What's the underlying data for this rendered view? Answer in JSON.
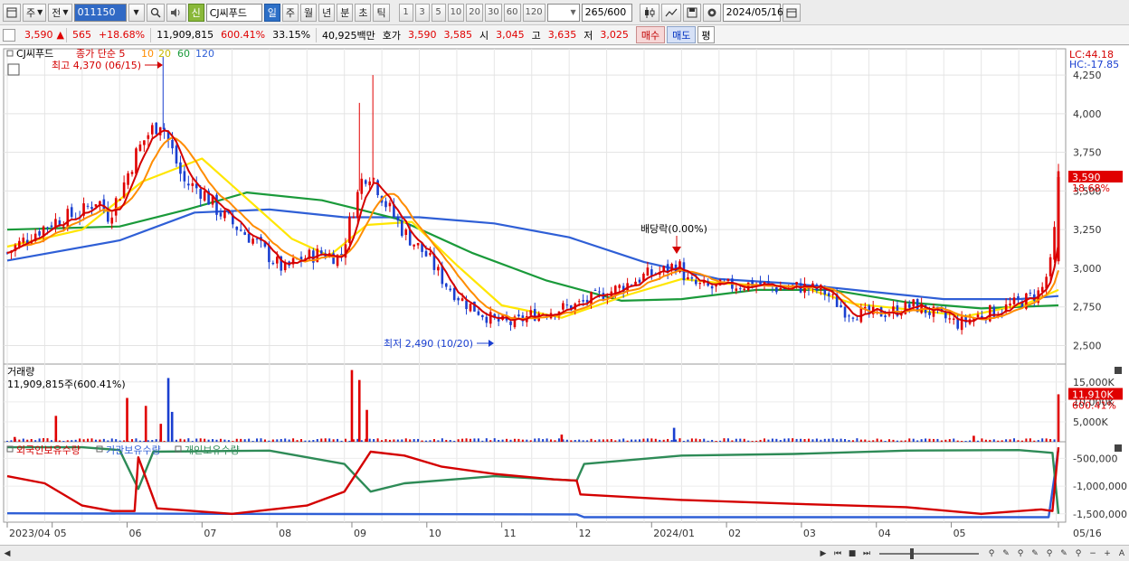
{
  "toolbar": {
    "period_type": "주",
    "compare": "전",
    "code": "011150",
    "badge": "신",
    "stock_name": "CJ씨푸드",
    "period_tabs": [
      "일",
      "주",
      "월",
      "년",
      "분",
      "초",
      "틱"
    ],
    "active_tab": "일",
    "minute_options": [
      "1",
      "3",
      "5",
      "10",
      "20",
      "30",
      "60",
      "120"
    ],
    "view_count": "265",
    "total_count": "/600",
    "date": "2024/05/16"
  },
  "quote": {
    "price": "3,590",
    "change_arrow": "▲",
    "change": "565",
    "change_pct": "+18.68%",
    "volume": "11,909,815",
    "volume_ratio": "600.41%",
    "turnover": "33.15%",
    "amount": "40,925백만",
    "bid_label": "호가",
    "ask": "3,590",
    "bid": "3,585",
    "open_label": "시",
    "open": "3,045",
    "high_label": "고",
    "high": "3,635",
    "low_label": "저",
    "low": "3,025",
    "buy_label": "매수",
    "sell_label": "매도",
    "avg_label": "평"
  },
  "chart_data": {
    "type": "line",
    "price_panel": {
      "stock_label": "CJ씨푸드",
      "legend_prefix": "종가 단순",
      "ma_periods": [
        "5",
        "10",
        "20",
        "60",
        "120"
      ],
      "ma_colors": [
        "#d40000",
        "#ff8c00",
        "#ffe600",
        "#1a9a3a",
        "#2f5fd6"
      ],
      "ylim": [
        2380,
        4420
      ],
      "yticks": [
        "2,500",
        "2,750",
        "3,000",
        "3,250",
        "3,500",
        "3,750",
        "4,000",
        "4,250"
      ],
      "ytick_values": [
        2500,
        2750,
        3000,
        3250,
        3500,
        3750,
        4000,
        4250
      ],
      "corner_top": "LC:44.18",
      "corner_bottom": "HC:-17.85",
      "last_price": "3,590",
      "last_pct": "18.68%",
      "high_annotation": "최고 4,370 (06/15)",
      "low_annotation": "최저 2,490 (10/20)",
      "dividend_annotation": "배당락(0.00%)",
      "close_series": [
        {
          "m": 0.0,
          "v": 3100
        },
        {
          "m": 0.3,
          "v": 3210
        },
        {
          "m": 0.6,
          "v": 3300
        },
        {
          "m": 1.0,
          "v": 3360
        },
        {
          "m": 1.2,
          "v": 3450
        },
        {
          "m": 1.35,
          "v": 3340
        },
        {
          "m": 1.5,
          "v": 3480
        },
        {
          "m": 1.7,
          "v": 3720
        },
        {
          "m": 1.85,
          "v": 3850
        },
        {
          "m": 2.05,
          "v": 3960
        },
        {
          "m": 2.2,
          "v": 3760
        },
        {
          "m": 2.35,
          "v": 3560
        },
        {
          "m": 2.6,
          "v": 3500
        },
        {
          "m": 2.8,
          "v": 3380
        },
        {
          "m": 3.0,
          "v": 3290
        },
        {
          "m": 3.3,
          "v": 3180
        },
        {
          "m": 3.55,
          "v": 3050
        },
        {
          "m": 3.7,
          "v": 2990
        },
        {
          "m": 3.9,
          "v": 3060
        },
        {
          "m": 4.2,
          "v": 3100
        },
        {
          "m": 4.45,
          "v": 3070
        },
        {
          "m": 4.6,
          "v": 3350
        },
        {
          "m": 4.75,
          "v": 3600
        },
        {
          "m": 4.85,
          "v": 3620
        },
        {
          "m": 5.05,
          "v": 3420
        },
        {
          "m": 5.3,
          "v": 3230
        },
        {
          "m": 5.6,
          "v": 3080
        },
        {
          "m": 5.85,
          "v": 2900
        },
        {
          "m": 6.1,
          "v": 2780
        },
        {
          "m": 6.5,
          "v": 2660
        },
        {
          "m": 6.75,
          "v": 2640
        },
        {
          "m": 7.0,
          "v": 2700
        },
        {
          "m": 7.3,
          "v": 2730
        },
        {
          "m": 7.6,
          "v": 2760
        },
        {
          "m": 7.9,
          "v": 2820
        },
        {
          "m": 8.2,
          "v": 2880
        },
        {
          "m": 8.5,
          "v": 2950
        },
        {
          "m": 8.75,
          "v": 2980
        },
        {
          "m": 8.95,
          "v": 3030
        },
        {
          "m": 9.1,
          "v": 2900
        },
        {
          "m": 9.4,
          "v": 2870
        },
        {
          "m": 9.7,
          "v": 2890
        },
        {
          "m": 10.0,
          "v": 2900
        },
        {
          "m": 10.3,
          "v": 2870
        },
        {
          "m": 10.6,
          "v": 2880
        },
        {
          "m": 10.9,
          "v": 2850
        },
        {
          "m": 11.2,
          "v": 2720
        },
        {
          "m": 11.5,
          "v": 2700
        },
        {
          "m": 11.8,
          "v": 2720
        },
        {
          "m": 12.1,
          "v": 2760
        },
        {
          "m": 12.4,
          "v": 2700
        },
        {
          "m": 12.7,
          "v": 2640
        },
        {
          "m": 13.0,
          "v": 2700
        },
        {
          "m": 13.3,
          "v": 2740
        },
        {
          "m": 13.6,
          "v": 2800
        },
        {
          "m": 13.8,
          "v": 2850
        },
        {
          "m": 13.95,
          "v": 3060
        },
        {
          "m": 14.03,
          "v": 3590
        }
      ],
      "ma20_series": [
        {
          "m": 0.0,
          "v": 3140
        },
        {
          "m": 1.0,
          "v": 3250
        },
        {
          "m": 1.8,
          "v": 3560
        },
        {
          "m": 2.6,
          "v": 3710
        },
        {
          "m": 3.2,
          "v": 3450
        },
        {
          "m": 3.8,
          "v": 3190
        },
        {
          "m": 4.3,
          "v": 3080
        },
        {
          "m": 4.8,
          "v": 3280
        },
        {
          "m": 5.4,
          "v": 3300
        },
        {
          "m": 6.0,
          "v": 3020
        },
        {
          "m": 6.6,
          "v": 2760
        },
        {
          "m": 7.4,
          "v": 2680
        },
        {
          "m": 8.3,
          "v": 2830
        },
        {
          "m": 9.0,
          "v": 2930
        },
        {
          "m": 9.6,
          "v": 2900
        },
        {
          "m": 10.6,
          "v": 2880
        },
        {
          "m": 11.3,
          "v": 2770
        },
        {
          "m": 12.1,
          "v": 2730
        },
        {
          "m": 12.8,
          "v": 2690
        },
        {
          "m": 13.6,
          "v": 2770
        },
        {
          "m": 14.03,
          "v": 2860
        }
      ],
      "ma60_series": [
        {
          "m": 0.0,
          "v": 3250
        },
        {
          "m": 1.5,
          "v": 3270
        },
        {
          "m": 2.4,
          "v": 3380
        },
        {
          "m": 3.2,
          "v": 3490
        },
        {
          "m": 4.2,
          "v": 3440
        },
        {
          "m": 5.2,
          "v": 3320
        },
        {
          "m": 6.2,
          "v": 3100
        },
        {
          "m": 7.2,
          "v": 2920
        },
        {
          "m": 8.2,
          "v": 2790
        },
        {
          "m": 9.0,
          "v": 2800
        },
        {
          "m": 10.0,
          "v": 2860
        },
        {
          "m": 11.0,
          "v": 2860
        },
        {
          "m": 12.0,
          "v": 2780
        },
        {
          "m": 13.0,
          "v": 2740
        },
        {
          "m": 14.03,
          "v": 2760
        }
      ],
      "ma120_series": [
        {
          "m": 0.0,
          "v": 3050
        },
        {
          "m": 1.5,
          "v": 3180
        },
        {
          "m": 2.5,
          "v": 3360
        },
        {
          "m": 3.5,
          "v": 3380
        },
        {
          "m": 4.5,
          "v": 3330
        },
        {
          "m": 5.5,
          "v": 3330
        },
        {
          "m": 6.5,
          "v": 3290
        },
        {
          "m": 7.5,
          "v": 3200
        },
        {
          "m": 8.5,
          "v": 3040
        },
        {
          "m": 9.5,
          "v": 2930
        },
        {
          "m": 10.5,
          "v": 2900
        },
        {
          "m": 11.5,
          "v": 2850
        },
        {
          "m": 12.5,
          "v": 2800
        },
        {
          "m": 13.5,
          "v": 2800
        },
        {
          "m": 14.03,
          "v": 2820
        }
      ]
    },
    "volume_panel": {
      "title": "거래량",
      "value_label": "11,909,815주(600.41%)",
      "yticks": [
        "5,000K",
        "10,000K",
        "15,000K"
      ],
      "ytick_values": [
        5000,
        10000,
        15000
      ],
      "ylim": [
        0,
        19500
      ],
      "last_label": "11,910K",
      "last_pct": "600.41%",
      "spikes_k": [
        {
          "m": 0.1,
          "v": 1200,
          "up": true
        },
        {
          "m": 0.65,
          "v": 6500,
          "up": true
        },
        {
          "m": 1.6,
          "v": 11000,
          "up": true
        },
        {
          "m": 1.85,
          "v": 9000,
          "up": true
        },
        {
          "m": 2.05,
          "v": 4500,
          "up": true
        },
        {
          "m": 2.15,
          "v": 16000,
          "up": false
        },
        {
          "m": 2.2,
          "v": 7500,
          "up": false
        },
        {
          "m": 4.6,
          "v": 18000,
          "up": true
        },
        {
          "m": 4.7,
          "v": 15500,
          "up": true
        },
        {
          "m": 4.8,
          "v": 8000,
          "up": true
        },
        {
          "m": 7.4,
          "v": 1800,
          "up": true
        },
        {
          "m": 8.9,
          "v": 3500,
          "up": false
        },
        {
          "m": 12.9,
          "v": 1500,
          "up": true
        },
        {
          "m": 14.03,
          "v": 11910,
          "up": true
        }
      ]
    },
    "holding_panel": {
      "legend": [
        "외국인보유수량",
        "기관보유수량",
        "개인보유수량"
      ],
      "legend_colors": [
        "#d40000",
        "#2f5fd6",
        "#2e8b57"
      ],
      "yticks": [
        "-1,500,000",
        "-1,000,000",
        "-500,000"
      ],
      "ytick_values": [
        -1500000,
        -1000000,
        -500000
      ],
      "ylim": [
        -1650000,
        -200000
      ],
      "foreign_series": [
        {
          "m": 0.0,
          "v": -820000
        },
        {
          "m": 0.5,
          "v": -950000
        },
        {
          "m": 1.0,
          "v": -1350000
        },
        {
          "m": 1.4,
          "v": -1450000
        },
        {
          "m": 1.7,
          "v": -1450000
        },
        {
          "m": 1.75,
          "v": -480000
        },
        {
          "m": 2.0,
          "v": -1400000
        },
        {
          "m": 3.0,
          "v": -1500000
        },
        {
          "m": 4.0,
          "v": -1350000
        },
        {
          "m": 4.5,
          "v": -1100000
        },
        {
          "m": 4.85,
          "v": -380000
        },
        {
          "m": 5.3,
          "v": -450000
        },
        {
          "m": 5.8,
          "v": -650000
        },
        {
          "m": 6.5,
          "v": -780000
        },
        {
          "m": 7.3,
          "v": -880000
        },
        {
          "m": 7.6,
          "v": -900000
        },
        {
          "m": 7.65,
          "v": -1150000
        },
        {
          "m": 9.0,
          "v": -1250000
        },
        {
          "m": 10.5,
          "v": -1320000
        },
        {
          "m": 12.0,
          "v": -1380000
        },
        {
          "m": 13.0,
          "v": -1500000
        },
        {
          "m": 13.8,
          "v": -1420000
        },
        {
          "m": 13.95,
          "v": -1450000
        },
        {
          "m": 14.03,
          "v": -300000
        }
      ],
      "inst_series": [
        {
          "m": 0.0,
          "v": -1490000
        },
        {
          "m": 3.0,
          "v": -1500000
        },
        {
          "m": 7.6,
          "v": -1510000
        },
        {
          "m": 7.7,
          "v": -1560000
        },
        {
          "m": 13.9,
          "v": -1560000
        },
        {
          "m": 14.03,
          "v": -320000
        }
      ],
      "indiv_series": [
        {
          "m": 0.0,
          "v": -300000
        },
        {
          "m": 1.0,
          "v": -300000
        },
        {
          "m": 1.5,
          "v": -350000
        },
        {
          "m": 1.75,
          "v": -1050000
        },
        {
          "m": 1.95,
          "v": -380000
        },
        {
          "m": 3.5,
          "v": -360000
        },
        {
          "m": 4.5,
          "v": -600000
        },
        {
          "m": 4.85,
          "v": -1100000
        },
        {
          "m": 5.3,
          "v": -950000
        },
        {
          "m": 6.5,
          "v": -820000
        },
        {
          "m": 7.6,
          "v": -900000
        },
        {
          "m": 7.7,
          "v": -600000
        },
        {
          "m": 9.0,
          "v": -450000
        },
        {
          "m": 10.5,
          "v": -420000
        },
        {
          "m": 12.0,
          "v": -360000
        },
        {
          "m": 13.5,
          "v": -350000
        },
        {
          "m": 13.95,
          "v": -400000
        },
        {
          "m": 14.03,
          "v": -1500000
        }
      ]
    },
    "x_axis": {
      "labels": [
        "2023/04",
        "05",
        "06",
        "07",
        "08",
        "09",
        "10",
        "11",
        "12",
        "2024/01",
        "02",
        "03",
        "04",
        "05",
        "05/16"
      ],
      "label_months": [
        0.0,
        0.6,
        1.6,
        2.6,
        3.6,
        4.6,
        5.6,
        6.6,
        7.6,
        8.6,
        9.6,
        10.6,
        11.6,
        12.6,
        14.03
      ]
    }
  }
}
